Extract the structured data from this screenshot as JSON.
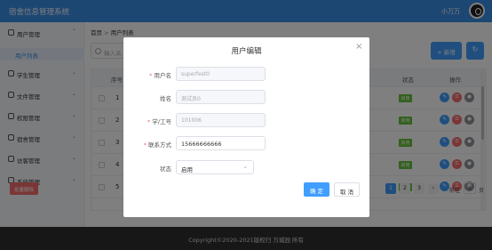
{
  "app": {
    "title": "宿舍信息管理系统",
    "user": "小万万"
  },
  "sidebar": {
    "items": [
      {
        "label": "用户管理",
        "icon": "user-icon"
      },
      {
        "label": "学生管理",
        "icon": "student-icon"
      },
      {
        "label": "文件管理",
        "icon": "file-icon"
      },
      {
        "label": "权限管理",
        "icon": "permission-icon"
      },
      {
        "label": "宿舍管理",
        "icon": "dorm-icon"
      },
      {
        "label": "访客管理",
        "icon": "visitor-icon"
      },
      {
        "label": "系统管理",
        "icon": "system-icon"
      }
    ],
    "sub_active": "用户列表"
  },
  "breadcrumb": {
    "home": "首页",
    "sep": ">",
    "current": "用户列表"
  },
  "search": {
    "placeholder": "输入关..."
  },
  "toolbar": {
    "new_label": "+ 新增",
    "refresh_label": "↻"
  },
  "table": {
    "headers": {
      "id": "序号",
      "state": "状态",
      "ops": "操作"
    },
    "rows": [
      {
        "num": "1",
        "state": "启用"
      },
      {
        "num": "2",
        "state": "启用"
      },
      {
        "num": "3",
        "state": "启用"
      },
      {
        "num": "4",
        "state": "启用"
      },
      {
        "num": "5",
        "state": "启用"
      }
    ],
    "ops": {
      "edit": "✎",
      "key": "⚿",
      "user": "●"
    }
  },
  "batch": {
    "label": "批量删除"
  },
  "pagination": {
    "pages": [
      "1",
      "2",
      "3"
    ],
    "active": "1",
    "next": "›",
    "goto": "前往",
    "input": "1",
    "unit": "页"
  },
  "footer": {
    "text": "Copyright©2020-2021版权归 万城园 所有"
  },
  "modal": {
    "title": "用户编辑",
    "close": "×",
    "fields": {
      "username": {
        "label": "用户名",
        "value": "superfest0"
      },
      "name": {
        "label": "姓名",
        "value": "测试员0"
      },
      "no": {
        "label": "学/工号",
        "value": "101006"
      },
      "phone": {
        "label": "联系方式",
        "value": "15666666666"
      },
      "status": {
        "label": "状态",
        "value": "启用"
      }
    },
    "ok": "确 定",
    "cancel": "取 消",
    "star": "*"
  }
}
